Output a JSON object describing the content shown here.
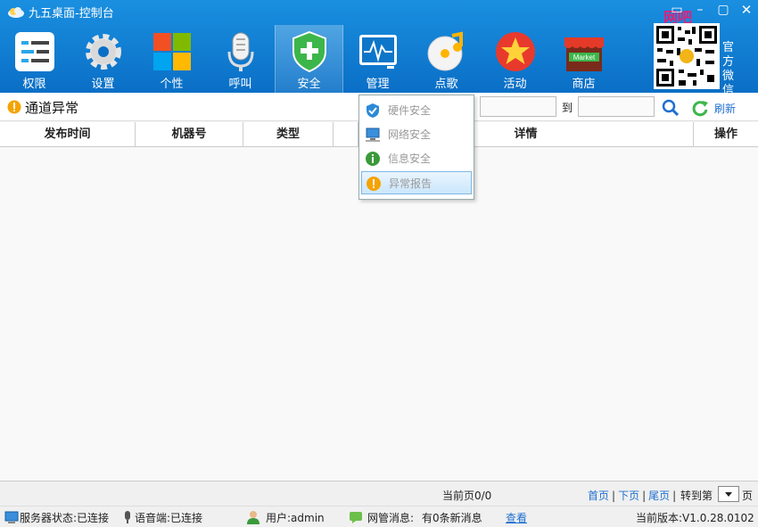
{
  "window": {
    "title": "九五桌面-控制台"
  },
  "toolbar": {
    "items": [
      {
        "label": "权限",
        "icon": "list-icon"
      },
      {
        "label": "设置",
        "icon": "gear-icon"
      },
      {
        "label": "个性",
        "icon": "windows-tiles-icon"
      },
      {
        "label": "呼叫",
        "icon": "microphone-icon"
      },
      {
        "label": "安全",
        "icon": "shield-icon",
        "active": true
      },
      {
        "label": "管理",
        "icon": "monitor-icon"
      },
      {
        "label": "点歌",
        "icon": "music-disc-icon"
      },
      {
        "label": "活动",
        "icon": "star-icon"
      },
      {
        "label": "商店",
        "icon": "market-icon"
      }
    ]
  },
  "qr": {
    "label": "官方微信",
    "watermark": "网吧"
  },
  "market_sign": "Market",
  "section": {
    "title": "通道异常"
  },
  "filter": {
    "to_label": "到",
    "refresh_label": "刷新"
  },
  "table": {
    "columns": [
      "发布时间",
      "机器号",
      "类型",
      "",
      "详情",
      "操作"
    ]
  },
  "dropdown": {
    "items": [
      {
        "label": "硬件安全",
        "icon": "shield-check-icon"
      },
      {
        "label": "网络安全",
        "icon": "network-icon"
      },
      {
        "label": "信息安全",
        "icon": "info-icon"
      },
      {
        "label": "异常报告",
        "icon": "warning-icon",
        "highlight": true
      }
    ]
  },
  "pager": {
    "page_info": "当前页0/0",
    "first": "首页",
    "next": "下页",
    "last": "尾页",
    "goto": "转到第",
    "unit": "页"
  },
  "status": {
    "server": "服务器状态:已连接",
    "voice": "语音端:已连接",
    "user": "用户:admin",
    "msg_label": "网管消息:",
    "msg_count": "有0条新消息",
    "view": "查看",
    "version": "当前版本:V1.0.28.0102"
  },
  "colors": {
    "titlebar": "#0a6fc6",
    "link": "#1e6fd0",
    "warning": "#f5a300"
  }
}
